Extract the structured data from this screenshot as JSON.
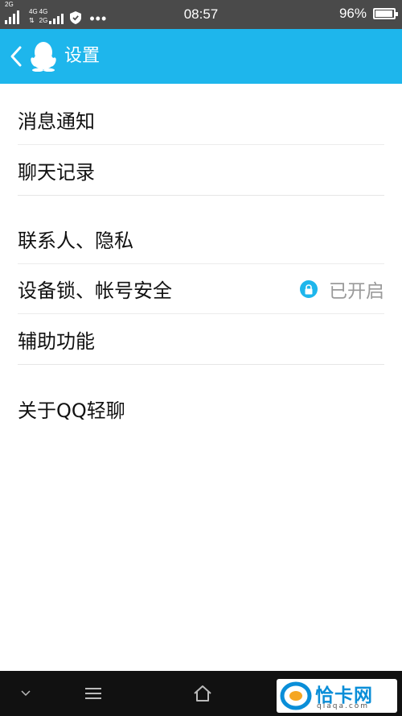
{
  "status_bar": {
    "net1": "2G",
    "net2": "4G",
    "net3": "4G",
    "net4": "2G",
    "dots": "•••",
    "time": "08:57",
    "battery": "96%",
    "battery_level": 0.96
  },
  "header": {
    "title": "设置"
  },
  "menu": {
    "group1": [
      "消息通知",
      "聊天记录"
    ],
    "group2": [
      "联系人、隐私",
      "设备锁、帐号安全",
      "辅助功能"
    ],
    "group3": [
      "关于QQ轻聊"
    ],
    "device_lock_status": "已开启"
  },
  "colors": {
    "accent": "#1eb6ec",
    "status_bar": "#4a4a4a",
    "nav_bar": "#111111"
  },
  "watermark": {
    "name": "恰卡网",
    "url": "qiaqa.com"
  }
}
